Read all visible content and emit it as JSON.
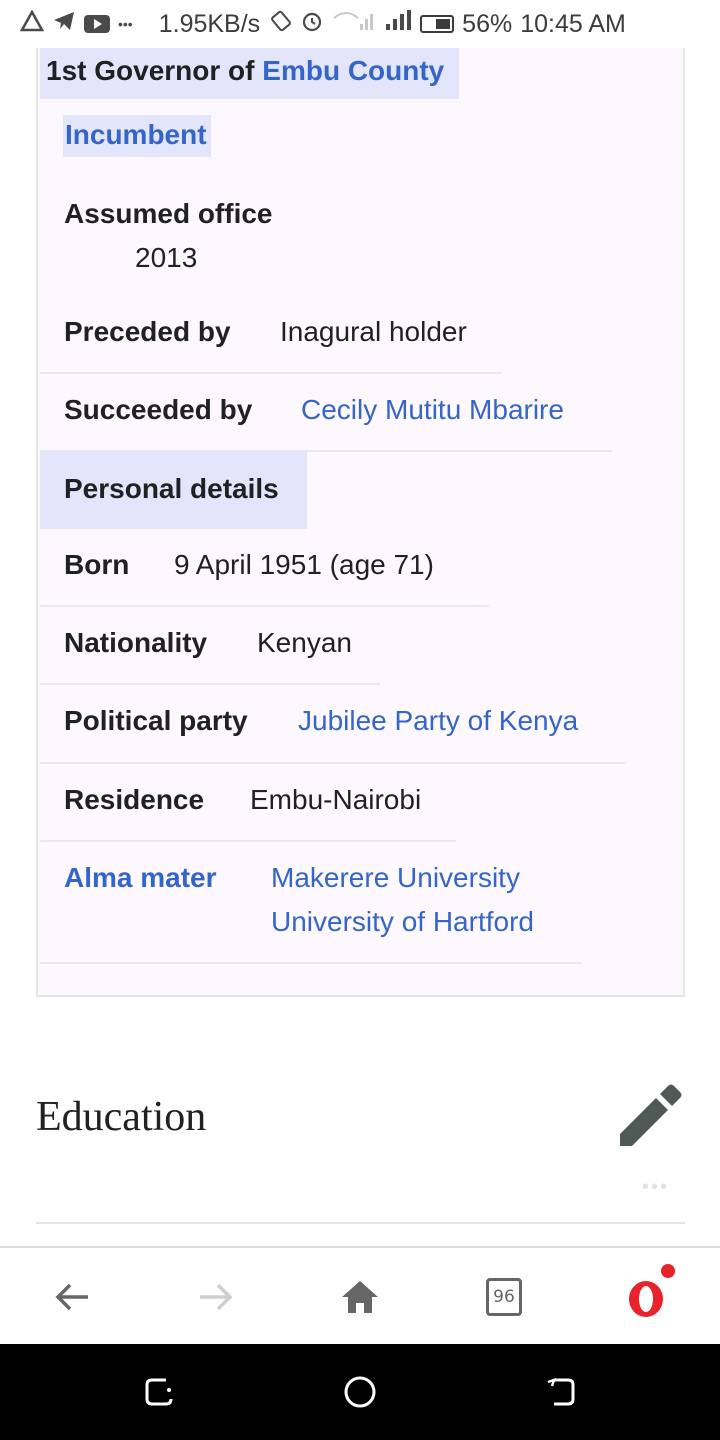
{
  "status_bar": {
    "network_speed": "1.95KB/s",
    "battery": "56%",
    "time": "10:45 AM",
    "more_dots": "•••"
  },
  "infobox": {
    "title_prefix": "1st Governor of ",
    "title_link": "Embu County",
    "incumbent": "Incumbent",
    "assumed_office_label": "Assumed office",
    "assumed_office_value": "2013",
    "preceded_by_label": "Preceded by",
    "preceded_by_value": "Inagural holder",
    "succeeded_by_label": "Succeeded by",
    "succeeded_by_value": "Cecily Mutitu Mbarire",
    "personal_details_header": "Personal details",
    "born_label": "Born",
    "born_value": "9 April 1951 (age 71)",
    "nationality_label": "Nationality",
    "nationality_value": "Kenyan",
    "party_label": "Political party",
    "party_value": "Jubilee Party of Kenya",
    "residence_label": "Residence",
    "residence_value": "Embu-Nairobi",
    "alma_mater_label": "Alma mater",
    "alma_mater_values": [
      "Makerere University",
      "University of Hartford"
    ]
  },
  "section": {
    "heading": "Education",
    "edit_icon": "pencil-icon"
  },
  "browser_bar": {
    "tab_count": "96",
    "icons": [
      "back-arrow-icon",
      "forward-arrow-icon",
      "home-icon",
      "tabs-icon",
      "opera-menu-icon"
    ]
  },
  "nav_bar": {
    "icons": [
      "recents-icon",
      "home-circle-icon",
      "back-icon"
    ]
  },
  "colors": {
    "link": "#3465c9",
    "infobox_bg": "#fdf8fd",
    "header_bg": "#e3e6fa",
    "opera_red": "#e8232b"
  }
}
